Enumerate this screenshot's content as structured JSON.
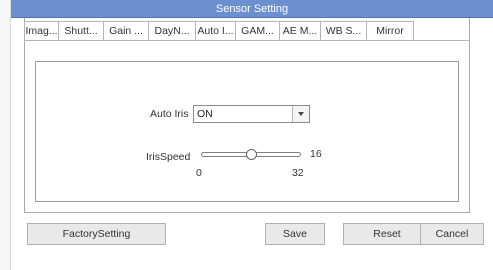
{
  "window": {
    "title": "Sensor Setting"
  },
  "tabs": [
    {
      "label": "Imag...",
      "active": false
    },
    {
      "label": "Shutt...",
      "active": false
    },
    {
      "label": "Gain ...",
      "active": false
    },
    {
      "label": "DayN...",
      "active": false
    },
    {
      "label": "Auto I...",
      "active": true
    },
    {
      "label": "GAM...",
      "active": false
    },
    {
      "label": "AE M...",
      "active": false
    },
    {
      "label": "WB S...",
      "active": false
    },
    {
      "label": "Mirror",
      "active": false
    }
  ],
  "auto_iris": {
    "label": "Auto Iris",
    "value": "ON"
  },
  "iris_speed": {
    "label": "IrisSpeed",
    "value": "16",
    "min": "0",
    "max": "32",
    "level": 0.5
  },
  "buttons": {
    "factory": "FactorySetting",
    "save": "Save",
    "reset": "Reset",
    "cancel": "Cancel"
  },
  "colors": {
    "title_bar": "#6b8fcf",
    "title_text": "#ffffff",
    "button_face": "#e9e9e9"
  },
  "icons": {
    "dropdown": "chevron-down-icon"
  }
}
